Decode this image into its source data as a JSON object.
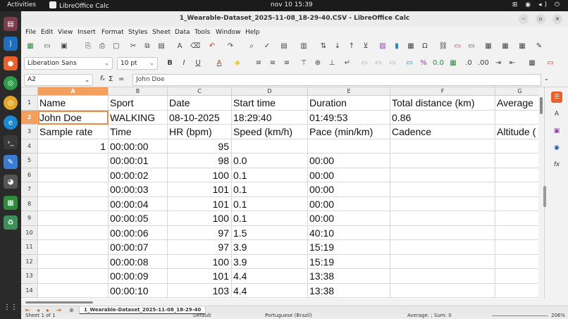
{
  "topbar": {
    "activities": "Activities",
    "app": "LibreOffice Calc",
    "clock": "nov 10  15:39"
  },
  "dock": {
    "icons": [
      "files-icon",
      "vscode-icon",
      "firefox-icon",
      "chrome-icon",
      "chrome-canary-icon",
      "edge-icon",
      "terminal-icon",
      "text-editor-icon",
      "gimp-icon",
      "calc-icon",
      "recycle-icon",
      "apps-grid-icon"
    ]
  },
  "window": {
    "title": "1_Wearable-Dataset_2025-11-08_18-29-40.CSV - LibreOffice Calc"
  },
  "menu": [
    "File",
    "Edit",
    "View",
    "Insert",
    "Format",
    "Styles",
    "Sheet",
    "Data",
    "Tools",
    "Window",
    "Help"
  ],
  "toolbar2": {
    "font_name": "Liberation Sans",
    "font_size": "10 pt"
  },
  "formula": {
    "namebox": "A2",
    "content": "John Doe",
    "fx": "fₓ",
    "sigma": "Σ",
    "eq": "="
  },
  "columns": [
    "A",
    "B",
    "C",
    "D",
    "E",
    "F",
    "G"
  ],
  "rows": [
    [
      "Name",
      "Sport",
      "Date",
      "Start time",
      "Duration",
      "Total distance (km)",
      "Average"
    ],
    [
      "John Doe",
      "WALKING",
      "08-10-2025",
      "18:29:40",
      "01:49:53",
      "0.86",
      ""
    ],
    [
      "Sample rate",
      "Time",
      "HR (bpm)",
      "Speed (km/h)",
      "Pace (min/km)",
      "Cadence",
      "Altitude ("
    ],
    [
      "1",
      "00:00:00",
      "95",
      "",
      "",
      "",
      ""
    ],
    [
      "",
      "00:00:01",
      "98",
      "0.0",
      "00:00",
      "",
      ""
    ],
    [
      "",
      "00:00:02",
      "100",
      "0.1",
      "00:00",
      "",
      ""
    ],
    [
      "",
      "00:00:03",
      "101",
      "0.1",
      "00:00",
      "",
      ""
    ],
    [
      "",
      "00:00:04",
      "101",
      "0.1",
      "00:00",
      "",
      ""
    ],
    [
      "",
      "00:00:05",
      "100",
      "0.1",
      "00:00",
      "",
      ""
    ],
    [
      "",
      "00:00:06",
      "97",
      "1.5",
      "40:10",
      "",
      ""
    ],
    [
      "",
      "00:00:07",
      "97",
      "3.9",
      "15:19",
      "",
      ""
    ],
    [
      "",
      "00:00:08",
      "100",
      "3.9",
      "15:19",
      "",
      ""
    ],
    [
      "",
      "00:00:09",
      "101",
      "4.4",
      "13:38",
      "",
      ""
    ],
    [
      "",
      "00:00:10",
      "103",
      "4.4",
      "13:38",
      "",
      ""
    ]
  ],
  "numeric_cols": [
    0,
    2
  ],
  "sheet": {
    "tab": "1_Wearable-Dataset_2025-11-08_18-29-40"
  },
  "status": {
    "sheet": "Sheet 1 of 1",
    "style": "Default",
    "language": "Portuguese (Brazil)",
    "summary": "Average: ; Sum: 0",
    "zoom": "206%"
  }
}
